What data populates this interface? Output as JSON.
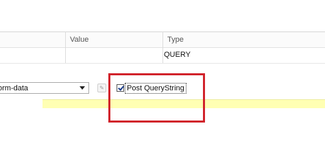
{
  "grid": {
    "columns": [
      "",
      "Value",
      "Type"
    ],
    "rows": [
      {
        "value": "",
        "type": "QUERY"
      }
    ]
  },
  "toolbar": {
    "encoding_select_value": "orm-data",
    "post_querystring_label": "Post QueryString",
    "post_querystring_checked": true
  },
  "annotation": {
    "highlight_color": "#d1232b"
  }
}
